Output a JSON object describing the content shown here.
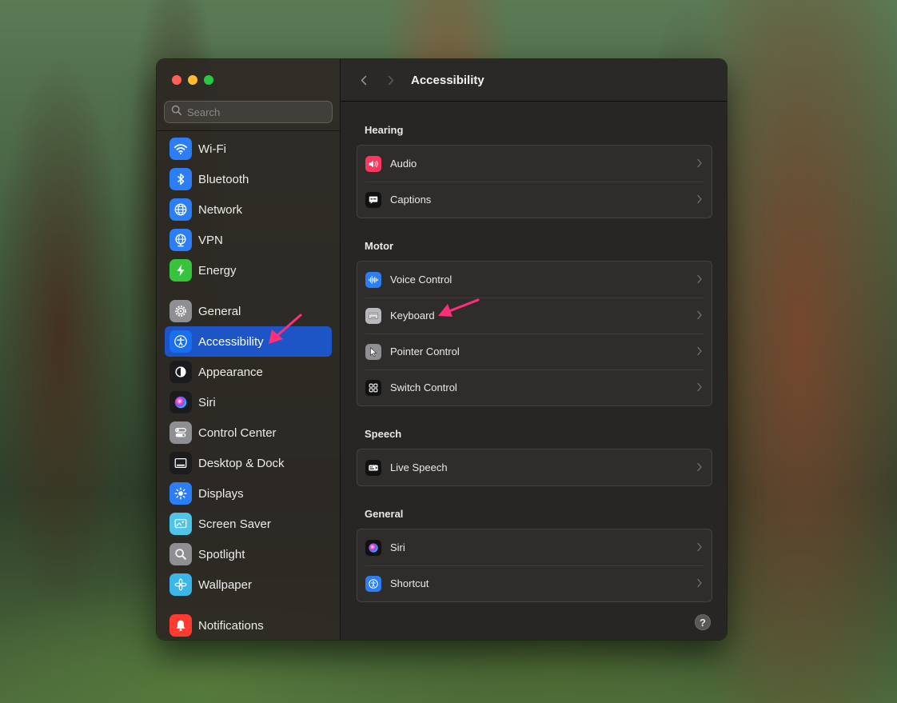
{
  "window": {
    "search": {
      "placeholder": "Search"
    }
  },
  "sidebar": {
    "items": [
      {
        "label": "Wi-Fi",
        "icon": "wifi-icon",
        "color": "#2b7ef6"
      },
      {
        "label": "Bluetooth",
        "icon": "bluetooth-icon",
        "color": "#2b7ef6"
      },
      {
        "label": "Network",
        "icon": "globe-icon",
        "color": "#2b7ef6"
      },
      {
        "label": "VPN",
        "icon": "vpn-globe-icon",
        "color": "#2b7ef6"
      },
      {
        "label": "Energy",
        "icon": "bolt-icon",
        "color": "#37c43c"
      },
      {
        "label": "General",
        "icon": "gear-icon",
        "color": "#8e8e93"
      },
      {
        "label": "Accessibility",
        "icon": "accessibility-icon",
        "color": "#1a6ef0",
        "active": true
      },
      {
        "label": "Appearance",
        "icon": "appearance-icon",
        "color": "#1c1c1e"
      },
      {
        "label": "Siri",
        "icon": "siri-icon",
        "color": "#1c1c1e"
      },
      {
        "label": "Control Center",
        "icon": "control-center-icon",
        "color": "#8e8e93"
      },
      {
        "label": "Desktop & Dock",
        "icon": "dock-icon",
        "color": "#1c1c1e"
      },
      {
        "label": "Displays",
        "icon": "sun-icon",
        "color": "#2b7ef6"
      },
      {
        "label": "Screen Saver",
        "icon": "screen-saver-icon",
        "color": "#4fc3e8"
      },
      {
        "label": "Spotlight",
        "icon": "magnifier-icon",
        "color": "#8e8e93"
      },
      {
        "label": "Wallpaper",
        "icon": "flower-icon",
        "color": "#3bb6e8"
      },
      {
        "label": "Notifications",
        "icon": "bell-icon",
        "color": "#ff3b30"
      }
    ]
  },
  "main": {
    "title": "Accessibility",
    "sections": [
      {
        "title": "Hearing",
        "rows": [
          {
            "label": "Audio",
            "icon": "speaker-icon",
            "color": "#ff375f"
          },
          {
            "label": "Captions",
            "icon": "caption-bubble-icon",
            "color": "#111111"
          }
        ]
      },
      {
        "title": "Motor",
        "rows": [
          {
            "label": "Voice Control",
            "icon": "waveform-icon",
            "color": "#2b7ef6"
          },
          {
            "label": "Keyboard",
            "icon": "keyboard-icon",
            "color": "#b9b9bd"
          },
          {
            "label": "Pointer Control",
            "icon": "pointer-icon",
            "color": "#8e8e93"
          },
          {
            "label": "Switch Control",
            "icon": "switch-grid-icon",
            "color": "#111111"
          }
        ]
      },
      {
        "title": "Speech",
        "rows": [
          {
            "label": "Live Speech",
            "icon": "live-speech-icon",
            "color": "#111111"
          }
        ]
      },
      {
        "title": "General",
        "rows": [
          {
            "label": "Siri",
            "icon": "siri-icon",
            "color": "#111111"
          },
          {
            "label": "Shortcut",
            "icon": "shortcut-icon",
            "color": "#2b7ef6"
          }
        ]
      }
    ],
    "help": "?"
  },
  "annotations": {
    "arrow_color": "#ff2d7a"
  }
}
